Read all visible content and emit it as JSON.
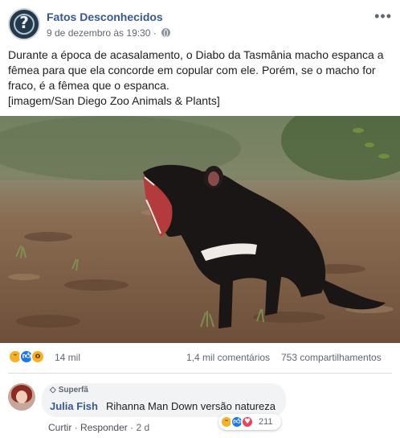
{
  "post": {
    "page_name": "Fatos Desconhecidos",
    "timestamp": "9 de dezembro às 19:30",
    "separator": "·",
    "more_icon": "more-options-icon",
    "text_lines": [
      "Durante a época de acasalamento, o Diabo da Tasmânia macho espanca a",
      "fêmea para que ela concorde em copular com ele. Porém, se o macho for",
      "fraco, é a fêmea que o espanca.",
      "[imagem/San Diego Zoo Animals & Plants]"
    ]
  },
  "reactions": {
    "count": "14 mil",
    "comments": "1,4 mil comentários",
    "shares": "753 compartilhamentos",
    "icons": [
      "haha-icon",
      "like-icon",
      "wow-icon"
    ]
  },
  "comment": {
    "badge": "Superfã",
    "author": "Julia Fish",
    "text": "Rihanna Man Down versão natureza",
    "actions": {
      "like": "Curtir",
      "sep1": "·",
      "reply": "Responder",
      "sep2": "·",
      "time": "2 d"
    },
    "reaction_count": "211",
    "reaction_icons": [
      "haha-icon",
      "like-icon",
      "love-icon"
    ]
  },
  "colors": {
    "link": "#365899",
    "like": "#1877f2",
    "love": "#f33e58",
    "haha": "#f7b125"
  }
}
